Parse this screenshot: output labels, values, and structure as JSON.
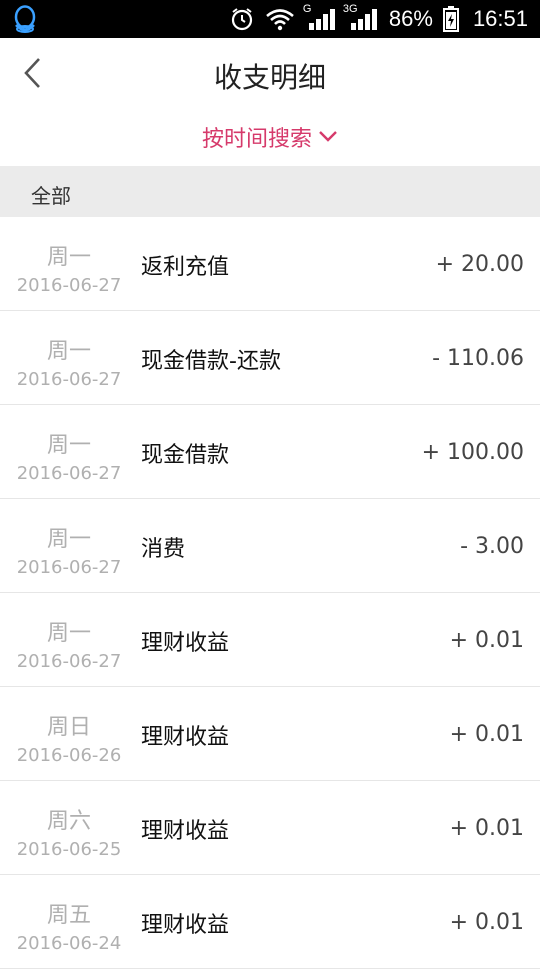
{
  "status_bar": {
    "battery_percent": "86%",
    "time": "16:51",
    "network_g": "G",
    "network_3g": "3G",
    "icons": [
      "qq-icon",
      "alarm-icon",
      "wifi-icon",
      "signal-icon",
      "battery-icon"
    ]
  },
  "header": {
    "title": "收支明细"
  },
  "filter": {
    "label": "按时间搜索"
  },
  "section": {
    "label": "全部"
  },
  "records": [
    {
      "week": "周一",
      "date": "2016-06-27",
      "name": "返利充值",
      "amount": "+ 20.00"
    },
    {
      "week": "周一",
      "date": "2016-06-27",
      "name": "现金借款-还款",
      "amount": "- 110.06"
    },
    {
      "week": "周一",
      "date": "2016-06-27",
      "name": "现金借款",
      "amount": "+ 100.00"
    },
    {
      "week": "周一",
      "date": "2016-06-27",
      "name": "消费",
      "amount": "- 3.00"
    },
    {
      "week": "周一",
      "date": "2016-06-27",
      "name": "理财收益",
      "amount": "+ 0.01"
    },
    {
      "week": "周日",
      "date": "2016-06-26",
      "name": "理财收益",
      "amount": "+ 0.01"
    },
    {
      "week": "周六",
      "date": "2016-06-25",
      "name": "理财收益",
      "amount": "+ 0.01"
    },
    {
      "week": "周五",
      "date": "2016-06-24",
      "name": "理财收益",
      "amount": "+ 0.01"
    }
  ],
  "colors": {
    "accent": "#d63a6b",
    "section_bg": "#ebebeb",
    "muted": "#b0b0b0"
  }
}
